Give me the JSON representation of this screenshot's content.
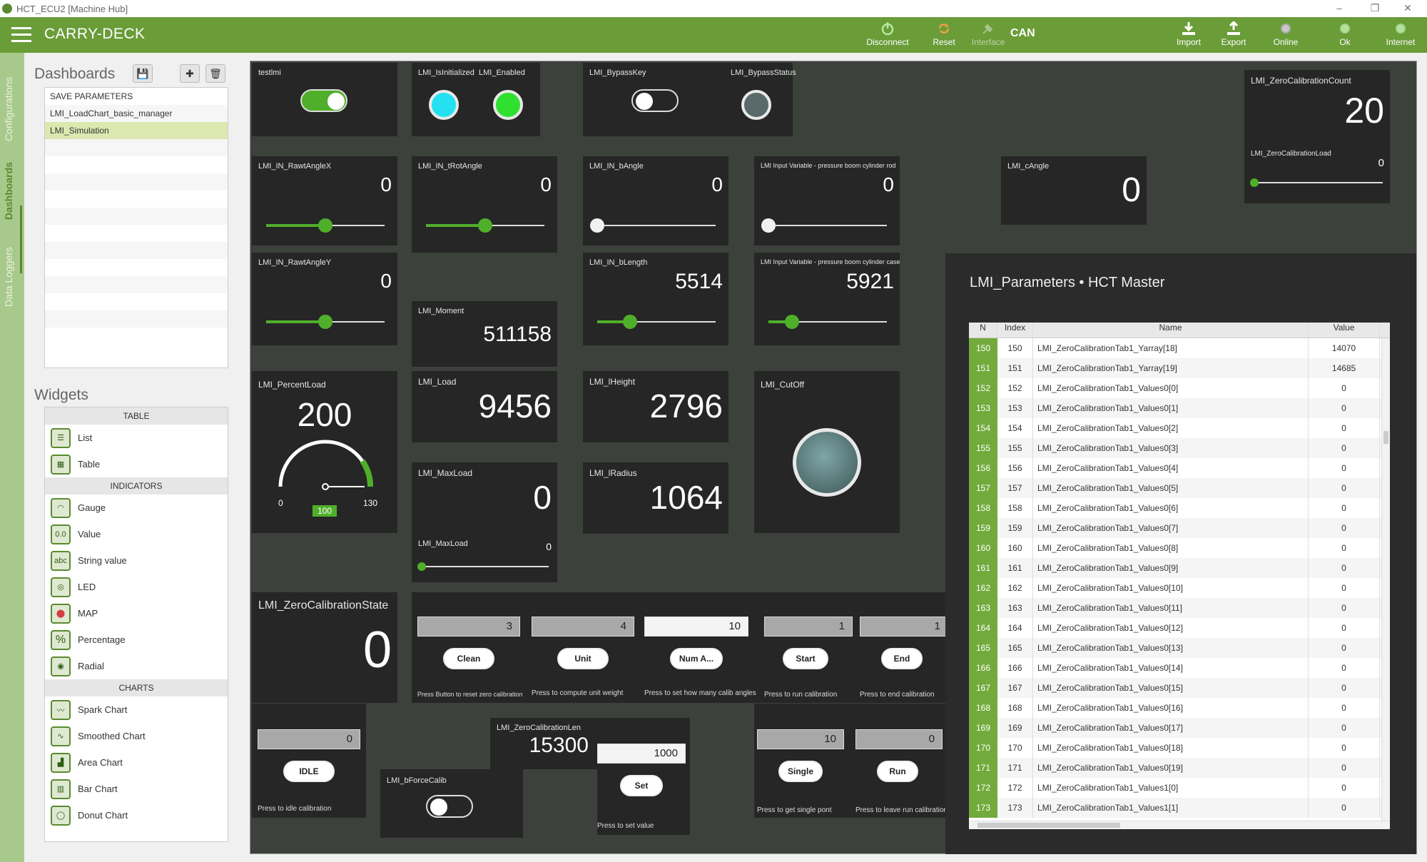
{
  "window": {
    "title": "HCT_ECU2 [Machine Hub]",
    "min": "–",
    "max": "❐",
    "close": "✕"
  },
  "app": {
    "title": "CARRY-DECK"
  },
  "toolbar": {
    "disconnect": "Disconnect",
    "reset": "Reset",
    "interface": "Interface",
    "can": "CAN",
    "import": "Import",
    "export": "Export",
    "online": "Online",
    "ok": "Ok",
    "internet": "Internet"
  },
  "vtabs": {
    "configurations": "Configurations",
    "dashboards": "Dashboards",
    "data_loggers": "Data Loggers"
  },
  "dashboards": {
    "heading": "Dashboards",
    "items": [
      "SAVE PARAMETERS",
      "LMI_LoadChart_basic_manager",
      "LMI_Simulation"
    ]
  },
  "widgets": {
    "heading": "Widgets",
    "cat_table": "TABLE",
    "list": "List",
    "table": "Table",
    "cat_indicators": "INDICATORS",
    "gauge": "Gauge",
    "value": "Value",
    "string_value": "String value",
    "led": "LED",
    "map": "MAP",
    "percentage": "Percentage",
    "radial": "Radial",
    "cat_charts": "CHARTS",
    "spark": "Spark Chart",
    "smoothed": "Smoothed Chart",
    "area": "Area Chart",
    "bar": "Bar Chart",
    "donut": "Donut Chart"
  },
  "w": {
    "testlmi": "testlmi",
    "isinit": "LMI_IsInitialized",
    "enabled": "LMI_Enabled",
    "bypasskey": "LMI_BypassKey",
    "bypassstatus": "LMI_BypassStatus",
    "zcc_label": "LMI_ZeroCalibrationCount",
    "zcc_val": "20",
    "zcl_label": "LMI_ZeroCalibrationLoad",
    "zcl_val": "0",
    "rax_label": "LMI_IN_RawtAngleX",
    "rax_val": "0",
    "tra_label": "LMI_IN_tRotAngle",
    "tra_val": "0",
    "ba_label": "LMI_IN_bAngle",
    "ba_val": "0",
    "prod_label": "LMI Input Variable - pressure boom cylinder rod",
    "prod_val": "0",
    "ca_label": "LMI_cAngle",
    "ca_val": "0",
    "ray_label": "LMI_IN_RawtAngleY",
    "ray_val": "0",
    "bl_label": "LMI_IN_bLength",
    "bl_val": "5514",
    "pcase_label": "LMI Input Variable - pressure boom cylinder case",
    "pcase_val": "5921",
    "mom_label": "LMI_Moment",
    "mom_val": "511158",
    "pl_label": "LMI_PercentLoad",
    "pl_val": "200",
    "pl_min": "0",
    "pl_max": "130",
    "pl_badge": "100",
    "load_label": "LMI_Load",
    "load_val": "9456",
    "lh_label": "LMI_lHeight",
    "lh_val": "2796",
    "cut_label": "LMI_CutOff",
    "ml_label": "LMI_MaxLoad",
    "ml_val": "0",
    "lr_label": "LMI_lRadius",
    "lr_val": "1064",
    "ml2_label": "LMI_MaxLoad",
    "ml2_val": "0",
    "zcs_label": "LMI_ZeroCalibrationState",
    "zcs_val": "0",
    "b1_val": "3",
    "b1_btn": "Clean",
    "b1_hint": "Press Button to reset zero calibration",
    "b2_val": "4",
    "b2_btn": "Unit",
    "b2_hint": "Press to compute unit weight",
    "b3_val": "10",
    "b3_btn": "Num A...",
    "b3_hint": "Press to set how many calib angles",
    "b4_val": "1",
    "b4_btn": "Start",
    "b4_hint": "Press to run calibration",
    "b5_val": "1",
    "b5_btn": "End",
    "b5_hint": "Press to end calibration",
    "idle_val": "0",
    "idle_btn": "IDLE",
    "idle_hint": "Press to idle calibration",
    "zclen_label": "LMI_ZeroCalibrationLen",
    "zclen_val": "15300",
    "set_val": "1000",
    "set_btn": "Set",
    "set_hint": "Press to set value",
    "bforce_label": "LMI_bForceCalib",
    "single_val": "10",
    "single_btn": "Single",
    "single_hint": "Press to get single pont",
    "run_val": "0",
    "run_btn": "Run",
    "run_hint": "Press to leave run calibration"
  },
  "params": {
    "title": "LMI_Parameters • HCT Master",
    "cols": [
      "N",
      "Index",
      "Name",
      "Value"
    ],
    "rows": [
      [
        "150",
        "150",
        "LMI_ZeroCalibrationTab1_Yarray[18]",
        "14070"
      ],
      [
        "151",
        "151",
        "LMI_ZeroCalibrationTab1_Yarray[19]",
        "14685"
      ],
      [
        "152",
        "152",
        "LMI_ZeroCalibrationTab1_Values0[0]",
        "0"
      ],
      [
        "153",
        "153",
        "LMI_ZeroCalibrationTab1_Values0[1]",
        "0"
      ],
      [
        "154",
        "154",
        "LMI_ZeroCalibrationTab1_Values0[2]",
        "0"
      ],
      [
        "155",
        "155",
        "LMI_ZeroCalibrationTab1_Values0[3]",
        "0"
      ],
      [
        "156",
        "156",
        "LMI_ZeroCalibrationTab1_Values0[4]",
        "0"
      ],
      [
        "157",
        "157",
        "LMI_ZeroCalibrationTab1_Values0[5]",
        "0"
      ],
      [
        "158",
        "158",
        "LMI_ZeroCalibrationTab1_Values0[6]",
        "0"
      ],
      [
        "159",
        "159",
        "LMI_ZeroCalibrationTab1_Values0[7]",
        "0"
      ],
      [
        "160",
        "160",
        "LMI_ZeroCalibrationTab1_Values0[8]",
        "0"
      ],
      [
        "161",
        "161",
        "LMI_ZeroCalibrationTab1_Values0[9]",
        "0"
      ],
      [
        "162",
        "162",
        "LMI_ZeroCalibrationTab1_Values0[10]",
        "0"
      ],
      [
        "163",
        "163",
        "LMI_ZeroCalibrationTab1_Values0[11]",
        "0"
      ],
      [
        "164",
        "164",
        "LMI_ZeroCalibrationTab1_Values0[12]",
        "0"
      ],
      [
        "165",
        "165",
        "LMI_ZeroCalibrationTab1_Values0[13]",
        "0"
      ],
      [
        "166",
        "166",
        "LMI_ZeroCalibrationTab1_Values0[14]",
        "0"
      ],
      [
        "167",
        "167",
        "LMI_ZeroCalibrationTab1_Values0[15]",
        "0"
      ],
      [
        "168",
        "168",
        "LMI_ZeroCalibrationTab1_Values0[16]",
        "0"
      ],
      [
        "169",
        "169",
        "LMI_ZeroCalibrationTab1_Values0[17]",
        "0"
      ],
      [
        "170",
        "170",
        "LMI_ZeroCalibrationTab1_Values0[18]",
        "0"
      ],
      [
        "171",
        "171",
        "LMI_ZeroCalibrationTab1_Values0[19]",
        "0"
      ],
      [
        "172",
        "172",
        "LMI_ZeroCalibrationTab1_Values1[0]",
        "0"
      ],
      [
        "173",
        "173",
        "LMI_ZeroCalibrationTab1_Values1[1]",
        "0"
      ]
    ]
  },
  "colors": {
    "accent": "#6a9c38",
    "green_led": "#2fe02f",
    "cyan_led": "#25e0f0"
  }
}
